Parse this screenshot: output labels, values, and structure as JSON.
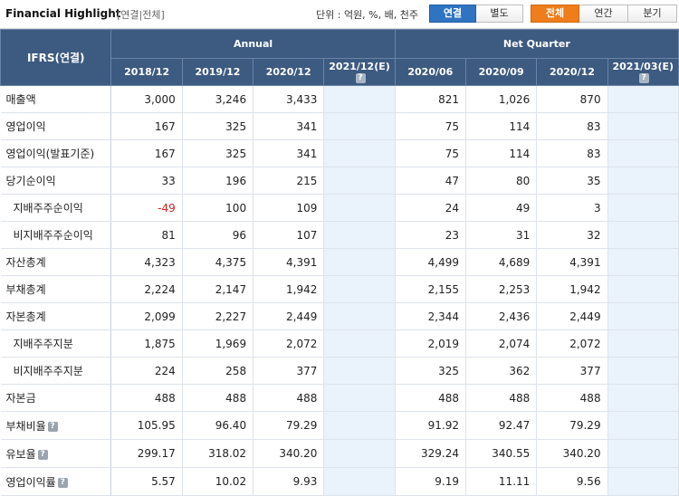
{
  "header": {
    "title": "Financial Highlight",
    "scope": "[연결|전체]",
    "unit": "단위 : 억원, %, 배, 천주",
    "consol_tabs": [
      "연결",
      "별도"
    ],
    "period_tabs": [
      "전체",
      "연간",
      "분기"
    ]
  },
  "table": {
    "label_header": "IFRS(연결)",
    "group_annual": "Annual",
    "group_quarter": "Net Quarter",
    "periods": [
      "2018/12",
      "2019/12",
      "2020/12",
      "2021/12(E)",
      "2020/06",
      "2020/09",
      "2020/12",
      "2021/03(E)"
    ],
    "help_icon": "?",
    "rows": [
      {
        "label": "매출액",
        "values": [
          "3,000",
          "3,246",
          "3,433",
          "",
          "821",
          "1,026",
          "870",
          ""
        ]
      },
      {
        "label": "영업이익",
        "values": [
          "167",
          "325",
          "341",
          "",
          "75",
          "114",
          "83",
          ""
        ]
      },
      {
        "label": "영업이익(발표기준)",
        "values": [
          "167",
          "325",
          "341",
          "",
          "75",
          "114",
          "83",
          ""
        ]
      },
      {
        "label": "당기순이익",
        "values": [
          "33",
          "196",
          "215",
          "",
          "47",
          "80",
          "35",
          ""
        ]
      },
      {
        "label": "지배주주순이익",
        "values": [
          "-49",
          "100",
          "109",
          "",
          "24",
          "49",
          "3",
          ""
        ]
      },
      {
        "label": "비지배주주순이익",
        "values": [
          "81",
          "96",
          "107",
          "",
          "23",
          "31",
          "32",
          ""
        ]
      },
      {
        "label": "자산총계",
        "values": [
          "4,323",
          "4,375",
          "4,391",
          "",
          "4,499",
          "4,689",
          "4,391",
          ""
        ]
      },
      {
        "label": "부채총계",
        "values": [
          "2,224",
          "2,147",
          "1,942",
          "",
          "2,155",
          "2,253",
          "1,942",
          ""
        ]
      },
      {
        "label": "자본총계",
        "values": [
          "2,099",
          "2,227",
          "2,449",
          "",
          "2,344",
          "2,436",
          "2,449",
          ""
        ]
      },
      {
        "label": "지배주주지분",
        "values": [
          "1,875",
          "1,969",
          "2,072",
          "",
          "2,019",
          "2,074",
          "2,072",
          ""
        ]
      },
      {
        "label": "비지배주주지분",
        "values": [
          "224",
          "258",
          "377",
          "",
          "325",
          "362",
          "377",
          ""
        ]
      },
      {
        "label": "자본금",
        "values": [
          "488",
          "488",
          "488",
          "",
          "488",
          "488",
          "488",
          ""
        ]
      },
      {
        "label": "부채비율",
        "values": [
          "105.95",
          "96.40",
          "79.29",
          "",
          "91.92",
          "92.47",
          "79.29",
          ""
        ]
      },
      {
        "label": "유보율",
        "values": [
          "299.17",
          "318.02",
          "340.20",
          "",
          "329.24",
          "340.55",
          "340.20",
          ""
        ]
      },
      {
        "label": "영업이익률",
        "values": [
          "5.57",
          "10.02",
          "9.93",
          "",
          "9.19",
          "11.11",
          "9.56",
          ""
        ]
      }
    ]
  },
  "colors": {
    "header_bg": "#3d5a80",
    "estimate_bg": "#eaf2fb",
    "negative": "#d32020",
    "tab_blue": "#2f74c0",
    "tab_orange": "#ef7d1b"
  }
}
